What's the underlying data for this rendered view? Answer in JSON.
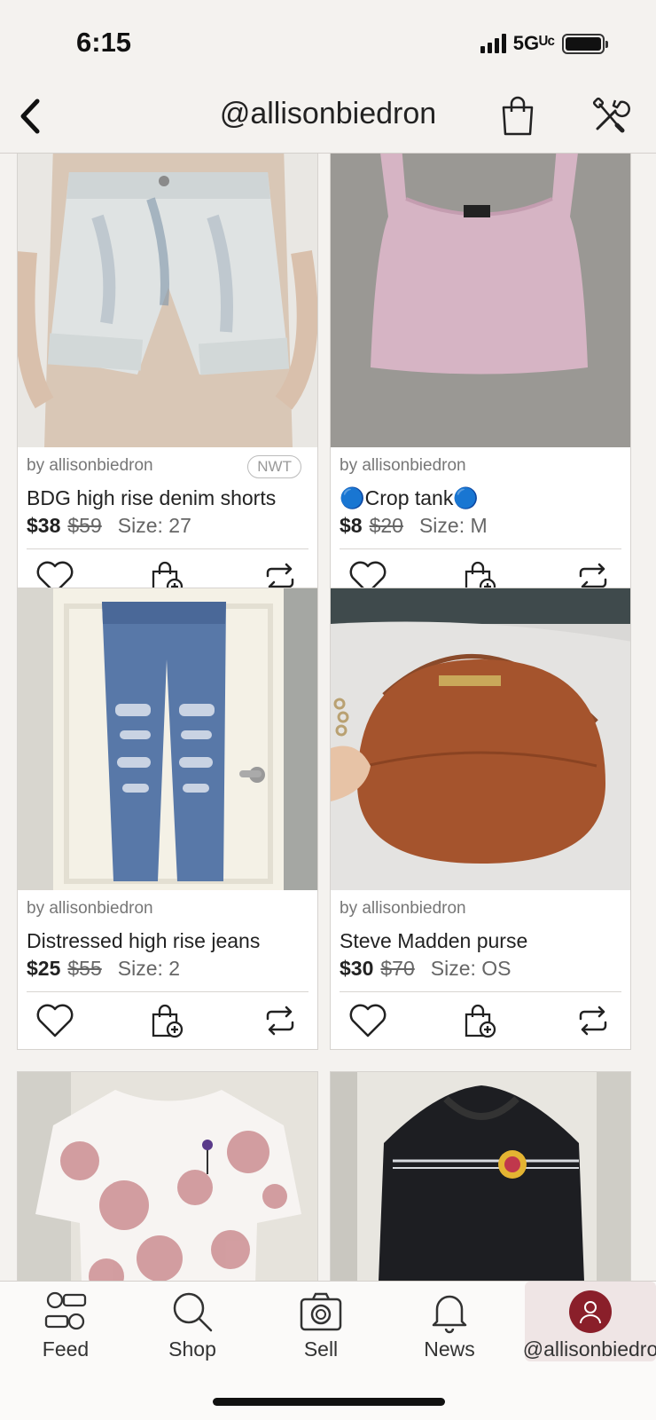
{
  "status_bar": {
    "time": "6:15",
    "network": "5Gᵁᶜ"
  },
  "header": {
    "title": "@allisonbiedron"
  },
  "listings": [
    {
      "seller": "by allisonbiedron",
      "badge": "NWT",
      "title": "BDG high rise denim shorts",
      "price": "$38",
      "original_price": "$59",
      "size": "Size: 27",
      "image": "light acid-wash denim shorts"
    },
    {
      "seller": "by allisonbiedron",
      "badge": "",
      "title": "🔵Crop tank🔵",
      "price": "$8",
      "original_price": "$20",
      "size": "Size: M",
      "image": "pink ribbed crop tank"
    },
    {
      "seller": "by allisonbiedron",
      "badge": "",
      "title": "Distressed high rise jeans",
      "price": "$25",
      "original_price": "$55",
      "size": "Size: 2",
      "image": "distressed blue jeans on door"
    },
    {
      "seller": "by allisonbiedron",
      "badge": "",
      "title": "Steve Madden purse",
      "price": "$30",
      "original_price": "$70",
      "size": "Size: OS",
      "image": "brown crossbody purse"
    },
    {
      "image": "pink tie-dye t-shirt"
    },
    {
      "image": "black hoodie with logo"
    }
  ],
  "tabbar": {
    "items": [
      {
        "label": "Feed",
        "icon": "feed-icon"
      },
      {
        "label": "Shop",
        "icon": "search-icon"
      },
      {
        "label": "Sell",
        "icon": "camera-icon"
      },
      {
        "label": "News",
        "icon": "bell-icon"
      },
      {
        "label": "@allisonbiedro",
        "icon": "avatar-icon"
      }
    ]
  },
  "colors": {
    "accent": "#8a1f2a",
    "background": "#f4f2ef"
  }
}
